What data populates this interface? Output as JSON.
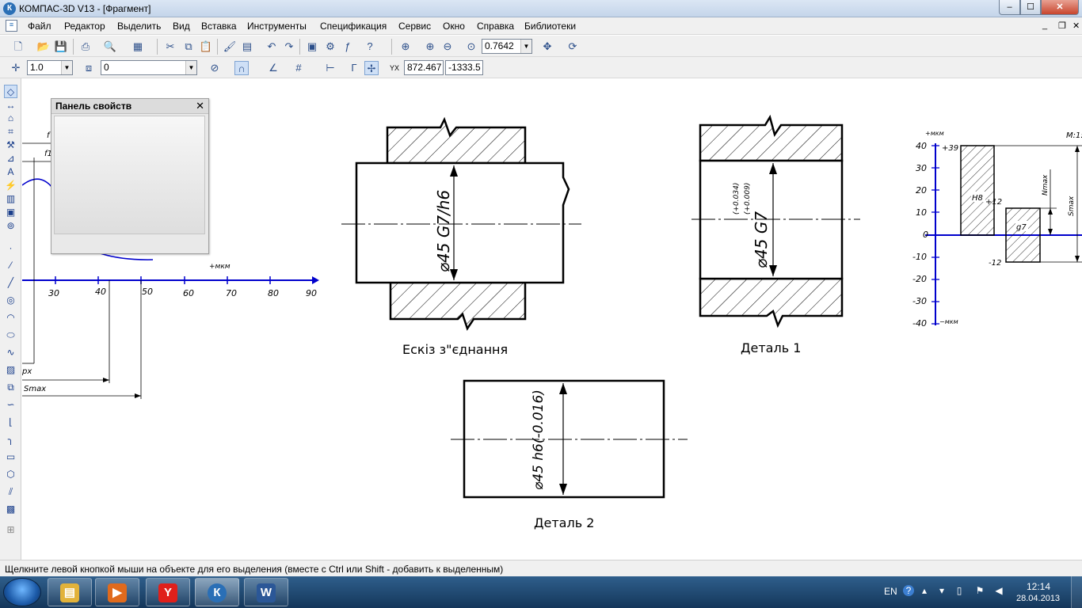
{
  "window": {
    "title": "КОМПАС-3D V13 - [Фрагмент]",
    "app_icon": "К",
    "min": "‒",
    "max": "☐",
    "close": "✕"
  },
  "menu": {
    "items": [
      "Файл",
      "Редактор",
      "Выделить",
      "Вид",
      "Вставка",
      "Инструменты",
      "Спецификация",
      "Сервис",
      "Окно",
      "Справка",
      "Библиотеки"
    ],
    "mdi_min": "_",
    "mdi_restore": "❐",
    "mdi_close": "✕"
  },
  "toolbar1": {
    "zoom_value": "0.7642"
  },
  "toolbar2": {
    "step_value": "1.0",
    "layer_value": "0",
    "coord_x": "872.467",
    "coord_y": "-1333.5"
  },
  "props_panel": {
    "title": "Панель свойств",
    "close": "✕"
  },
  "status": {
    "text": "Щелкните левой кнопкой мыши на объекте для его выделения (вместе с Ctrl или Shift - добавить к выделенным)"
  },
  "drawing": {
    "left_graph": {
      "ticks": [
        "30",
        "40",
        "50",
        "60",
        "70",
        "80",
        "90"
      ],
      "unit": "+мкм",
      "label_smax": "Smax",
      "label_px": "px",
      "label_f1": "f1",
      "label_f": "f"
    },
    "sketch": {
      "dimension": "⌀45 G7/h6",
      "caption": "Ескіз з\"єднання"
    },
    "part1": {
      "dimension": "⌀45 G7",
      "tol_upper": "(+0.034)",
      "tol_lower": "(+0.009)",
      "caption": "Деталь 1"
    },
    "part2": {
      "dimension": "⌀45 h6(-0.016)",
      "caption": "Деталь 2"
    },
    "tolerance_chart": {
      "unit_top": "+мкм",
      "unit_bottom": "−мкм",
      "scale_label": "М:1:",
      "axis_ticks": [
        "40",
        "30",
        "20",
        "10",
        "0",
        "-10",
        "-20",
        "-30",
        "-40"
      ],
      "hole_label": "H8",
      "hole_upper": "+39",
      "shaft_label": "g7",
      "shaft_upper": "+12",
      "shaft_lower": "-12",
      "label_nmax": "Nmax",
      "label_smax": "Smax"
    }
  },
  "taskbar": {
    "tray_lang": "EN",
    "clock_time": "12:14",
    "clock_date": "28.04.2013",
    "apps": [
      {
        "name": "explorer",
        "glyph": "▤",
        "color": "#e2b23a"
      },
      {
        "name": "media",
        "glyph": "▶",
        "color": "#e06a1c"
      },
      {
        "name": "yandex",
        "glyph": "Y",
        "color": "#e0201b"
      },
      {
        "name": "kompas",
        "glyph": "К",
        "color": "#2a6fb6"
      },
      {
        "name": "word",
        "glyph": "W",
        "color": "#2b5797"
      }
    ]
  }
}
